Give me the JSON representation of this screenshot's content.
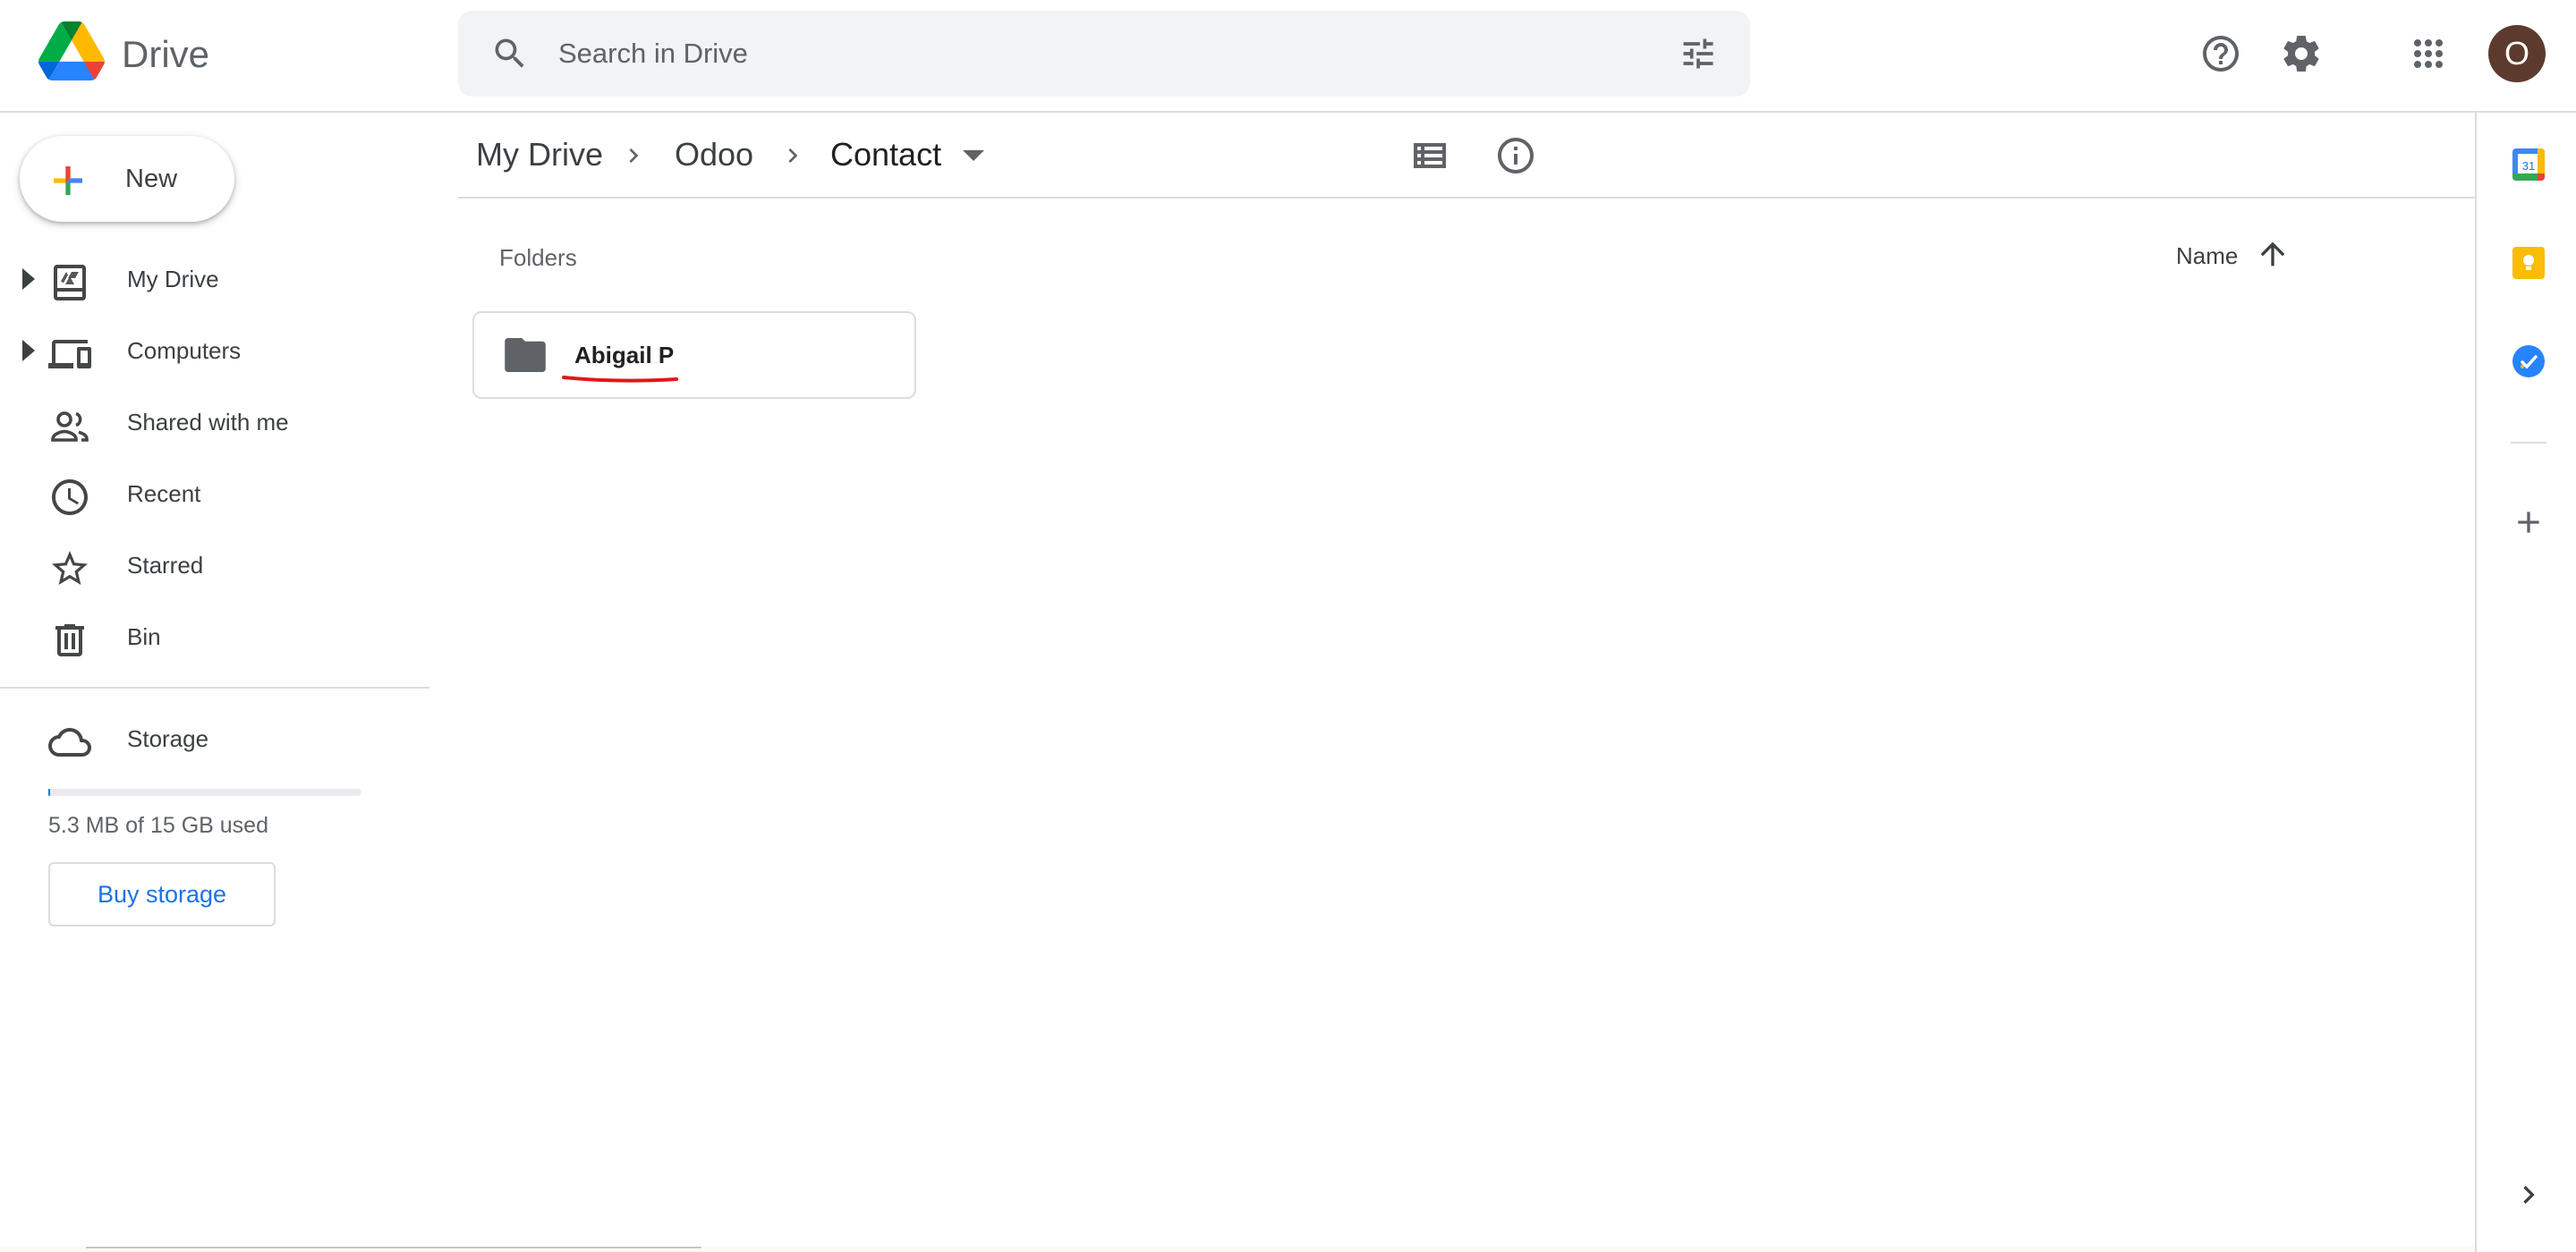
{
  "header": {
    "product_name": "Drive",
    "search_placeholder": "Search in Drive",
    "avatar_initial": "O"
  },
  "icons": {
    "logo": "google-drive-logo",
    "search": "search-icon",
    "tune": "tune-icon",
    "help": "help-icon",
    "settings": "gear-icon",
    "apps": "apps-grid-icon"
  },
  "sidebar": {
    "new_label": "New",
    "items": [
      {
        "label": "My Drive",
        "icon": "my-drive-icon",
        "expandable": true
      },
      {
        "label": "Computers",
        "icon": "computers-icon",
        "expandable": true
      },
      {
        "label": "Shared with me",
        "icon": "shared-icon",
        "expandable": false
      },
      {
        "label": "Recent",
        "icon": "clock-icon",
        "expandable": false
      },
      {
        "label": "Starred",
        "icon": "star-icon",
        "expandable": false
      },
      {
        "label": "Bin",
        "icon": "trash-icon",
        "expandable": false
      }
    ],
    "storage": {
      "label": "Storage",
      "used_text": "5.3 MB of 15 GB used",
      "used_fraction": 0.0004,
      "buy_label": "Buy storage"
    }
  },
  "breadcrumb": [
    "My Drive",
    "Odoo",
    "Contact"
  ],
  "main": {
    "section_title": "Folders",
    "sort_label": "Name",
    "sort_direction": "ascending",
    "folders": [
      {
        "name": "Abigail P"
      }
    ]
  },
  "side_panel": {
    "apps": [
      "calendar-icon",
      "keep-icon",
      "tasks-icon",
      "add-icon"
    ],
    "calendar_day": "31"
  },
  "colors": {
    "accent": "#1a73e8",
    "annotation": "#e3161c",
    "avatar": "#5d3a2e",
    "keep": "#fbbc04"
  }
}
